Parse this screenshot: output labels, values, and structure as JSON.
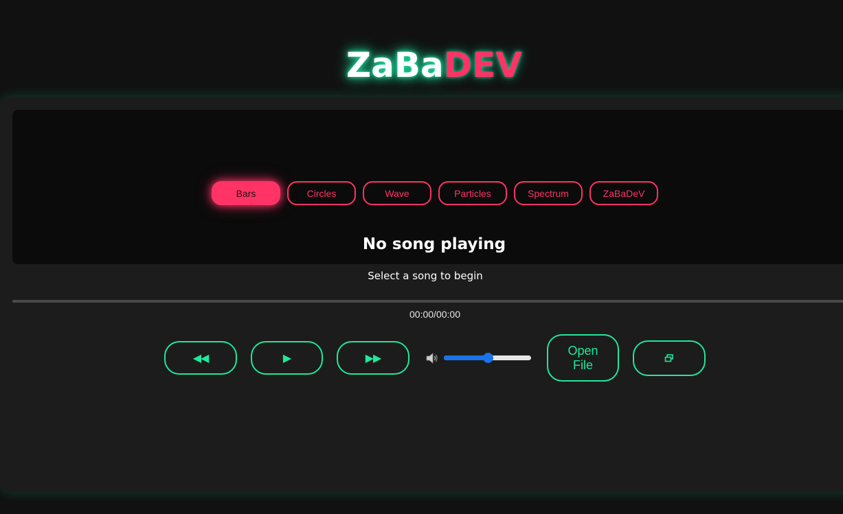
{
  "brand": {
    "part1": "ZaBa",
    "part2": "DEV",
    "color_part1": "#ffffff",
    "color_part2": "#ff3366",
    "glow_color": "#1fe89a"
  },
  "visualizer_modes": {
    "active": "Bars",
    "items": [
      {
        "label": "Bars"
      },
      {
        "label": "Circles"
      },
      {
        "label": "Wave"
      },
      {
        "label": "Particles"
      },
      {
        "label": "Spectrum"
      },
      {
        "label": "ZaBaDeV"
      }
    ]
  },
  "now_playing": {
    "title": "No song playing",
    "subtitle": "Select a song to begin"
  },
  "playback": {
    "progress_fraction": 0,
    "time_display": "00:00/00:00"
  },
  "controls": {
    "prev_icon": "rewind-icon",
    "prev_glyph": "◀◀",
    "play_icon": "play-icon",
    "play_glyph": "▶",
    "next_icon": "fast-forward-icon",
    "next_glyph": "▶▶",
    "volume_icon": "speaker-icon",
    "volume_fraction": 0.5,
    "open_file_label": "Open File",
    "mini_player_icon": "restore-window-icon"
  },
  "colors": {
    "accent_pink": "#ff3366",
    "accent_green": "#1fe89a",
    "slider_blue": "#1a73e8",
    "panel_bg": "#1c1c1c",
    "canvas_bg": "#0b0b0b",
    "page_bg": "#111111"
  }
}
